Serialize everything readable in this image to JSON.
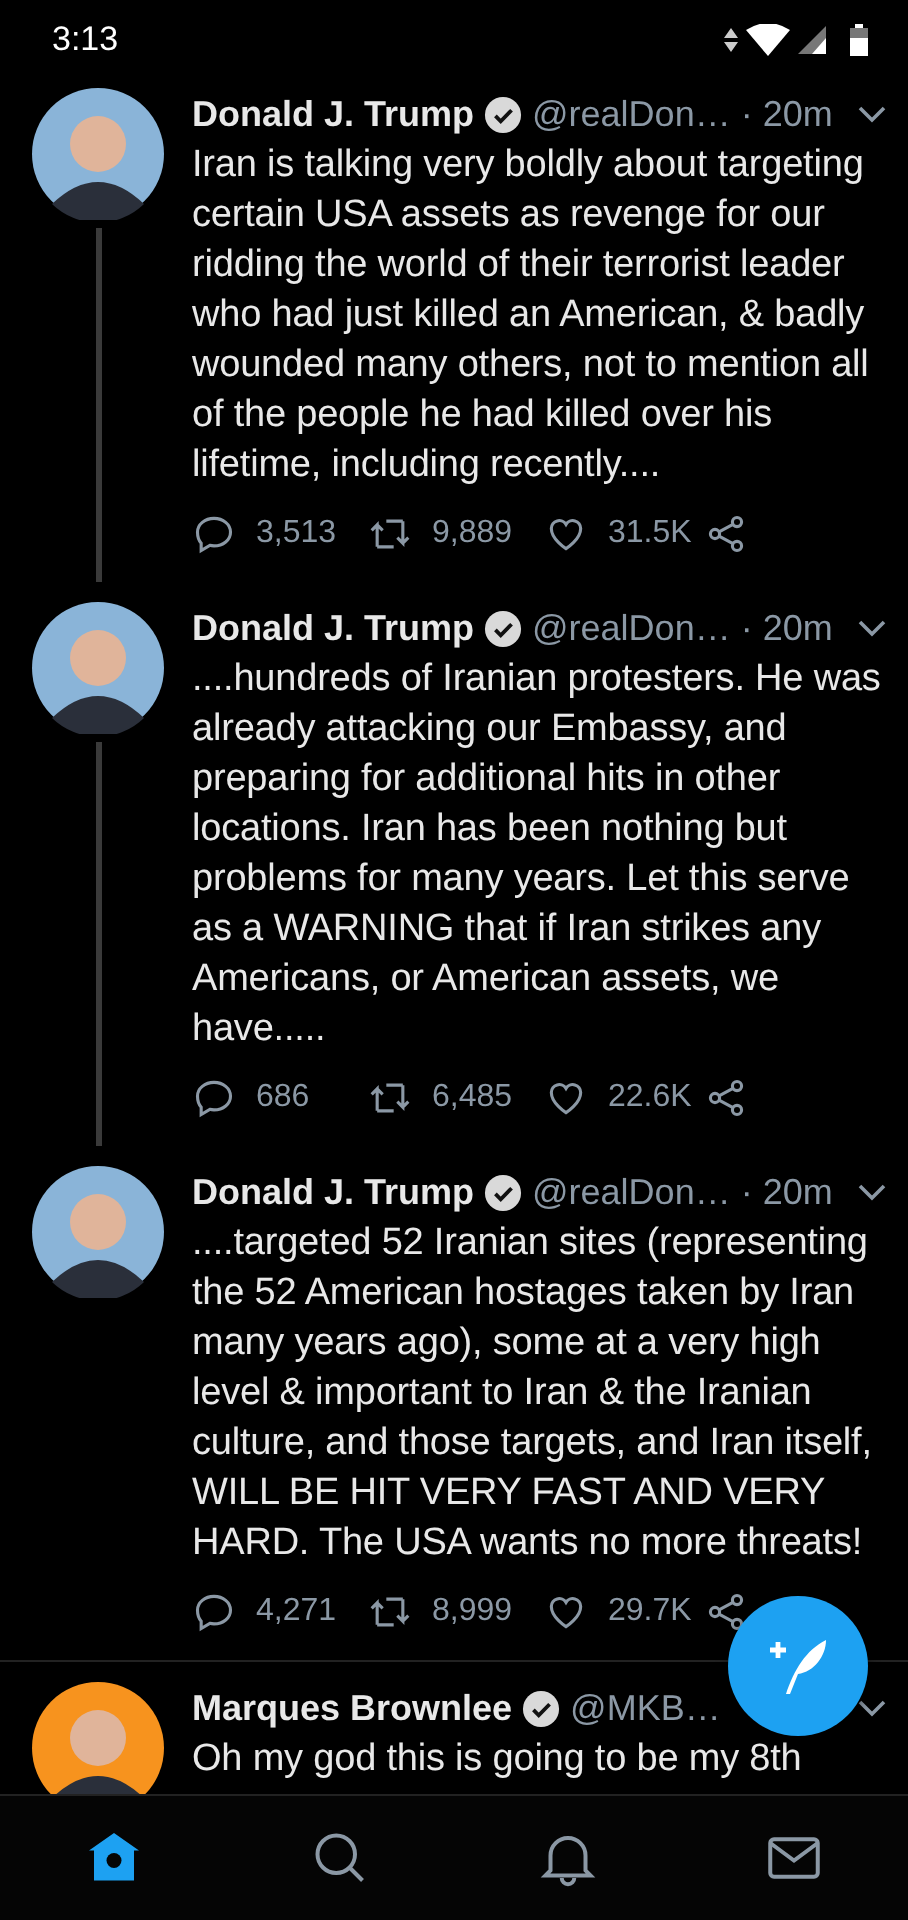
{
  "status_bar": {
    "time": "3:13"
  },
  "tweets": [
    {
      "name": "Donald J. Trump",
      "verified": true,
      "handle": "@realDon…",
      "time": "· 20m",
      "color": "#8ab4d8",
      "thread_line": true,
      "text": "Iran is talking very boldly about targeting certain USA assets as revenge for our ridding the world of their terrorist leader who had just killed an American, & badly wounded many others, not to mention all of the people he had killed over his lifetime, including recently....",
      "replies": "3,513",
      "retweets": "9,889",
      "likes": "31.5K"
    },
    {
      "name": "Donald J. Trump",
      "verified": true,
      "handle": "@realDon…",
      "time": "· 20m",
      "color": "#8ab4d8",
      "thread_line": true,
      "text": "....hundreds of Iranian protesters. He was already attacking our Embassy, and preparing for additional hits in other locations. Iran has been nothing but problems for many years. Let this serve as a WARNING that if Iran strikes any Americans, or American assets, we have.....",
      "replies": "686",
      "retweets": "6,485",
      "likes": "22.6K"
    },
    {
      "name": "Donald J. Trump",
      "verified": true,
      "handle": "@realDon…",
      "time": "· 20m",
      "color": "#8ab4d8",
      "thread_line": false,
      "text": "....targeted 52 Iranian sites (representing the 52 American hostages taken by Iran many years ago), some at a very high level & important to Iran &  the Iranian culture, and those targets, and Iran itself, WILL BE HIT VERY FAST AND VERY HARD. The USA wants no more threats!",
      "replies": "4,271",
      "retweets": "8,999",
      "likes": "29.7K"
    },
    {
      "name": "Marques Brownlee",
      "verified": true,
      "handle": "@MKB…",
      "color": "#f7931e",
      "thread_line": false,
      "text": "Oh my god this is going to be my 8th"
    }
  ],
  "nav": [
    {
      "kind": "home",
      "selected": true
    },
    {
      "kind": "search",
      "selected": false
    },
    {
      "kind": "notifications",
      "selected": false
    },
    {
      "kind": "messages",
      "selected": false
    }
  ]
}
